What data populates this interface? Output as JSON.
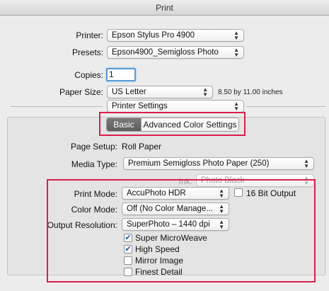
{
  "window": {
    "title": "Print"
  },
  "printer": {
    "label": "Printer:",
    "value": "Epson Stylus Pro 4900"
  },
  "presets": {
    "label": "Presets:",
    "value": "Epson4900_Semigloss Photo"
  },
  "copies": {
    "label": "Copies:",
    "value": "1"
  },
  "paper_size": {
    "label": "Paper Size:",
    "value": "US Letter",
    "dimensions": "8.50 by 11.00 inches"
  },
  "section": {
    "value": "Printer Settings"
  },
  "tabs": {
    "basic": "Basic",
    "advanced": "Advanced Color Settings"
  },
  "page_setup": {
    "label": "Page Setup:",
    "value": "Roll Paper"
  },
  "media_type": {
    "label": "Media Type:",
    "value": "Premium Semigloss Photo Paper (250)"
  },
  "ink": {
    "label": "Ink:",
    "value": "Photo Black"
  },
  "print_mode": {
    "label": "Print Mode:",
    "value": "AccuPhoto HDR",
    "bit16_label": "16 Bit Output"
  },
  "color_mode": {
    "label": "Color Mode:",
    "value": "Off (No Color Manage..."
  },
  "output_resolution": {
    "label": "Output Resolution:",
    "value": "SuperPhoto – 1440 dpi"
  },
  "options": [
    {
      "label": "Super MicroWeave",
      "checked": true
    },
    {
      "label": "High Speed",
      "checked": true
    },
    {
      "label": "Mirror Image",
      "checked": false
    },
    {
      "label": "Finest Detail",
      "checked": false
    }
  ],
  "icons": {
    "popup_arrows": "updown-arrows-icon",
    "check": "checkmark-icon"
  },
  "colors": {
    "highlight_box": "#d6204a",
    "focus_ring": "#5b9bd5",
    "selected_tab": "#6b6b6b"
  }
}
